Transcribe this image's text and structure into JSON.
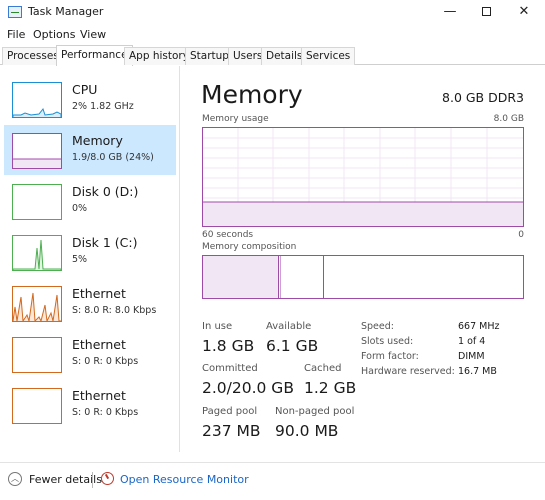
{
  "window": {
    "title": "Task Manager"
  },
  "menu": [
    "File",
    "Options",
    "View"
  ],
  "tabs": [
    "Processes",
    "Performance",
    "App history",
    "Startup",
    "Users",
    "Details",
    "Services"
  ],
  "active_tab": "Performance",
  "resources": [
    {
      "name": "CPU",
      "sub": "2%  1.82 GHz",
      "color": "#1a8fd6"
    },
    {
      "name": "Memory",
      "sub": "1.9/8.0 GB (24%)",
      "color": "#a04aa8"
    },
    {
      "name": "Disk 0 (D:)",
      "sub": "0%",
      "color": "#4caf50"
    },
    {
      "name": "Disk 1 (C:)",
      "sub": "5%",
      "color": "#4caf50"
    },
    {
      "name": "Ethernet",
      "sub": "S: 8.0  R: 8.0 Kbps",
      "color": "#d2691e"
    },
    {
      "name": "Ethernet",
      "sub": "S: 0  R: 0 Kbps",
      "color": "#d2691e"
    },
    {
      "name": "Ethernet",
      "sub": "S: 0  R: 0 Kbps",
      "color": "#d2691e"
    }
  ],
  "selected_resource": "Memory",
  "main": {
    "title": "Memory",
    "spec": "8.0 GB DDR3",
    "usage_label": "Memory usage",
    "usage_max": "8.0 GB",
    "axis_left": "60 seconds",
    "axis_right": "0",
    "composition_label": "Memory composition",
    "usage_fraction": 0.24
  },
  "stats": {
    "in_use_label": "In use",
    "in_use": "1.8 GB",
    "available_label": "Available",
    "available": "6.1 GB",
    "committed_label": "Committed",
    "committed": "2.0/20.0 GB",
    "cached_label": "Cached",
    "cached": "1.2 GB",
    "paged_label": "Paged pool",
    "paged": "237 MB",
    "nonpaged_label": "Non-paged pool",
    "nonpaged": "90.0 MB"
  },
  "details": [
    {
      "label": "Speed:",
      "value": "667 MHz"
    },
    {
      "label": "Slots used:",
      "value": "1 of 4"
    },
    {
      "label": "Form factor:",
      "value": "DIMM"
    },
    {
      "label": "Hardware reserved:",
      "value": "16.7 MB"
    }
  ],
  "footer": {
    "fewer": "Fewer details",
    "monitor": "Open Resource Monitor"
  }
}
